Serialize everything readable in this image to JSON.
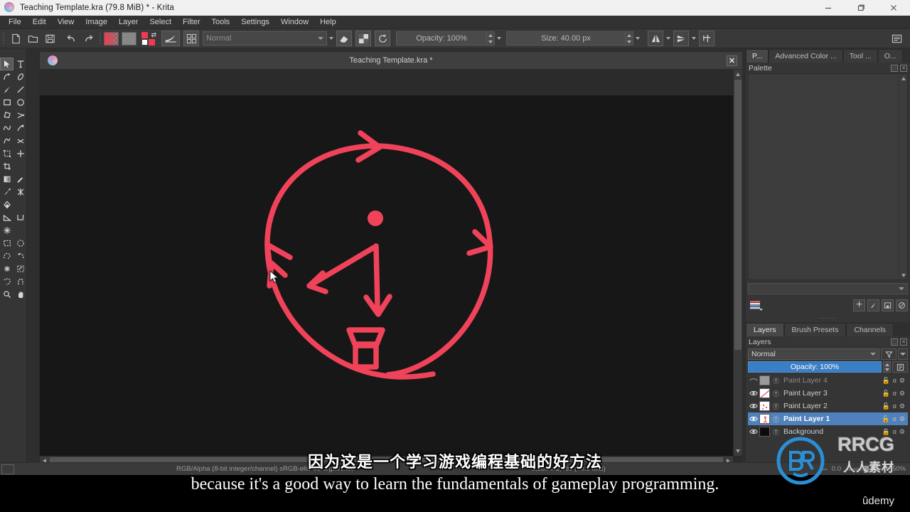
{
  "window": {
    "title": "Teaching Template.kra (79.8 MiB)  * - Krita",
    "minimize_label": "–",
    "restore_label": "❐",
    "close_label": "✕",
    "app_icon": "krita-logo-icon"
  },
  "menubar": {
    "items": [
      "File",
      "Edit",
      "View",
      "Image",
      "Layer",
      "Select",
      "Filter",
      "Tools",
      "Settings",
      "Window",
      "Help"
    ]
  },
  "toolbar": {
    "new_label": "new-file-icon",
    "open_label": "open-folder-icon",
    "save_label": "save-disk-icon",
    "undo_label": "undo-icon",
    "redo_label": "redo-icon",
    "foreground_color": "#ef3a52",
    "background_color": "#888888",
    "blending_mode": "Normal",
    "blending_placeholder": "Normal",
    "opacity_label": "Opacity:  100%",
    "opacity_value": "100%",
    "size_label": "Size:  40.00 px",
    "size_value": "40.00 px",
    "eraser_tooltip": "eraser-icon",
    "preserve_alpha_tooltip": "preserve-alpha-icon",
    "reload_tooltip": "reload-preset-icon",
    "mirror_h_tooltip": "mirror-horizontal-icon",
    "mirror_v_tooltip": "mirror-vertical-icon",
    "wrap_tooltip": "wrap-around-icon",
    "workspace_tooltip": "workspace-switcher-icon"
  },
  "toolbox": {
    "tools": [
      {
        "name": "shape-select-tool",
        "glyph": "▶",
        "selected": true
      },
      {
        "name": "text-tool",
        "glyph": "T",
        "selected": false
      },
      {
        "name": "edit-shapes-tool",
        "glyph": "↰",
        "selected": false
      },
      {
        "name": "calligraphy-tool",
        "glyph": "✎",
        "selected": false
      },
      {
        "name": "freehand-brush-tool",
        "glyph": "✐",
        "selected": false
      },
      {
        "name": "line-tool",
        "glyph": "╱",
        "selected": false
      },
      {
        "name": "rectangle-tool",
        "glyph": "□",
        "selected": false
      },
      {
        "name": "ellipse-tool",
        "glyph": "○",
        "selected": false
      },
      {
        "name": "polygon-tool",
        "glyph": "⬠",
        "selected": false
      },
      {
        "name": "polyline-tool",
        "glyph": "⊿",
        "selected": false
      },
      {
        "name": "bezier-curve-tool",
        "glyph": "∿",
        "selected": false
      },
      {
        "name": "freehand-path-tool",
        "glyph": "⤳",
        "selected": false
      },
      {
        "name": "dynamic-brush-tool",
        "glyph": "➰",
        "selected": false
      },
      {
        "name": "multibrush-tool",
        "glyph": "✈",
        "selected": false
      },
      {
        "name": "transform-tool",
        "glyph": "⧉",
        "selected": false
      },
      {
        "name": "move-tool",
        "glyph": "✚",
        "selected": false
      },
      {
        "name": "crop-tool",
        "glyph": "⌧",
        "selected": false
      },
      {
        "name": "gradient-tool",
        "glyph": "▤",
        "selected": false
      },
      {
        "name": "color-sampler-tool",
        "glyph": "⚒",
        "selected": false
      },
      {
        "name": "colorize-mask-tool",
        "glyph": "✏",
        "selected": false
      },
      {
        "name": "smart-patch-tool",
        "glyph": "✳",
        "selected": false
      },
      {
        "name": "fill-tool",
        "glyph": "◆",
        "selected": false
      },
      {
        "name": "measure-tool",
        "glyph": "◢",
        "selected": false
      },
      {
        "name": "reference-images-tool",
        "glyph": "⌐",
        "selected": false
      },
      {
        "name": "assistant-tool",
        "glyph": "✶",
        "selected": false
      },
      {
        "name": "rectangular-selection-tool",
        "glyph": "⬚",
        "selected": false
      },
      {
        "name": "elliptical-selection-tool",
        "glyph": "◌",
        "selected": false
      },
      {
        "name": "polygonal-selection-tool",
        "glyph": "⬡",
        "selected": false
      },
      {
        "name": "freehand-selection-tool",
        "glyph": "⟳",
        "selected": false
      },
      {
        "name": "contiguous-selection-tool",
        "glyph": "✦",
        "selected": false
      },
      {
        "name": "similar-color-selection-tool",
        "glyph": "❉",
        "selected": false
      },
      {
        "name": "bezier-selection-tool",
        "glyph": "⬢",
        "selected": false
      },
      {
        "name": "magnetic-selection-tool",
        "glyph": "⧫",
        "selected": false
      },
      {
        "name": "zoom-tool",
        "glyph": "⚲",
        "selected": false
      },
      {
        "name": "pan-tool",
        "glyph": "✋",
        "selected": false
      }
    ]
  },
  "subwindow": {
    "title": "Teaching Template.kra *",
    "close_label": "✕"
  },
  "palette_docker": {
    "tabs": [
      {
        "label": "P...",
        "active": true
      },
      {
        "label": "Advanced Color ...",
        "active": false
      },
      {
        "label": "Tool ...",
        "active": false
      },
      {
        "label": "O...",
        "active": false
      }
    ],
    "header": "Palette",
    "float_icon": "float-docker-icon",
    "close_icon": "close-docker-icon",
    "add_label": "+",
    "edit_label": "✎",
    "folder_label": "▤",
    "forbidden_label": "⊘"
  },
  "layers_docker": {
    "tabs": [
      {
        "label": "Layers",
        "active": true
      },
      {
        "label": "Brush Presets",
        "active": false
      },
      {
        "label": "Channels",
        "active": false
      }
    ],
    "header": "Layers",
    "blend_mode": "Normal",
    "opacity_label": "Opacity:  100%",
    "filter_icon": "filter-funnel-icon",
    "layers": [
      {
        "name": "Paint Layer 4",
        "visible": false,
        "selected": false,
        "locked": false,
        "thumb": "gray"
      },
      {
        "name": "Paint Layer 3",
        "visible": true,
        "selected": false,
        "locked": false,
        "thumb": "line"
      },
      {
        "name": "Paint Layer 2",
        "visible": true,
        "selected": false,
        "locked": false,
        "thumb": "dots"
      },
      {
        "name": "Paint Layer 1",
        "visible": true,
        "selected": true,
        "locked": false,
        "thumb": "sketch"
      },
      {
        "name": "Background",
        "visible": true,
        "selected": false,
        "locked": true,
        "thumb": "black"
      }
    ],
    "alpha_glyph": "α",
    "lock_glyph": "ὑ2",
    "props_glyph": "⚙"
  },
  "statusbar": {
    "color_space": "RGB/Alpha (8-bit integer/channel)  sRGB-elle-V2-srgbtrc.icc",
    "image_size": "3,508 x 2,480 (79.8 MiB)",
    "zoom_value": "0.0",
    "zoom_percent": "50%",
    "minus_label": "—"
  },
  "subtitles": {
    "chinese": "因为这是一个学习游戏编程基础的好方法",
    "english": "because it's a good way to learn the fundamentals of gameplay programming."
  },
  "watermark": {
    "brand": "RRCG",
    "chinese": "人人素材",
    "platform": "ûdemy"
  },
  "canvas": {
    "stroke_color": "#f0435a",
    "background_color": "#171717",
    "description": "hand-drawn red circle with direction arrows, a center dot, radius line with arrow, and a small cup shape at bottom"
  }
}
